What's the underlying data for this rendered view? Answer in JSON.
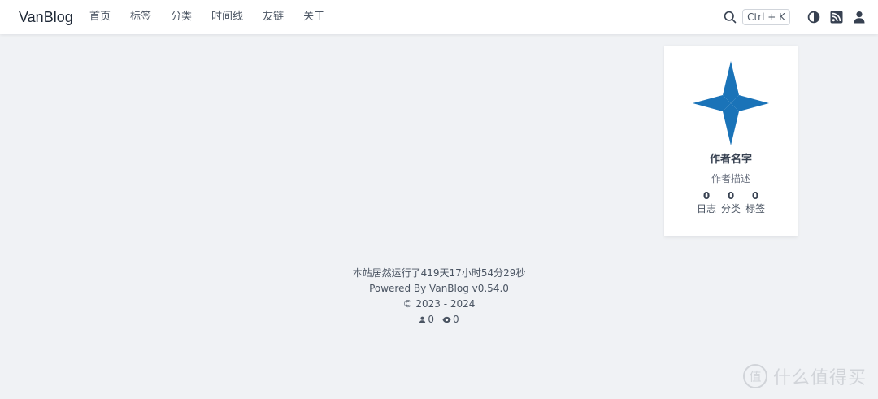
{
  "header": {
    "brand": "VanBlog",
    "nav": [
      "首页",
      "标签",
      "分类",
      "时间线",
      "友链",
      "关于"
    ],
    "search_shortcut": "Ctrl + K",
    "icons": [
      "search-icon",
      "theme-toggle-icon",
      "rss-icon",
      "user-icon"
    ]
  },
  "author": {
    "name": "作者名字",
    "description": "作者描述",
    "stats": [
      {
        "count": "0",
        "label": "日志"
      },
      {
        "count": "0",
        "label": "分类"
      },
      {
        "count": "0",
        "label": "标签"
      }
    ],
    "logo_color": "#1a73b8"
  },
  "footer": {
    "uptime": "本站居然运行了419天17小时54分29秒",
    "powered": "Powered By VanBlog v0.54.0",
    "copyright": "© 2023 - 2024",
    "visitors": "0",
    "views": "0"
  },
  "watermark": {
    "text": "什么值得买",
    "logo_glyph": "值"
  }
}
